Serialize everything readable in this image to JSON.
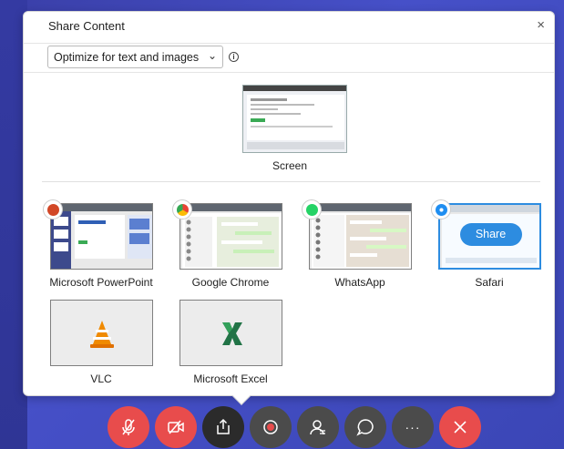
{
  "dialog": {
    "title": "Share Content",
    "close_glyph": "×",
    "optimize": {
      "selected": "Optimize for text and images",
      "chevron": "⌄",
      "info_glyph": "i"
    }
  },
  "screen": {
    "label": "Screen"
  },
  "apps": [
    {
      "label": "Microsoft PowerPoint",
      "icon": "powerpoint-icon",
      "color": "#d24726"
    },
    {
      "label": "Google Chrome",
      "icon": "chrome-icon",
      "color": "#4285f4"
    },
    {
      "label": "WhatsApp",
      "icon": "whatsapp-icon",
      "color": "#25d366"
    },
    {
      "label": "Safari",
      "icon": "safari-icon",
      "color": "#1f8ef1",
      "selected": true,
      "share_label": "Share"
    },
    {
      "label": "VLC",
      "icon": "vlc-icon",
      "color": "#f08a00"
    },
    {
      "label": "Microsoft Excel",
      "icon": "excel-icon",
      "color": "#217346"
    }
  ],
  "toolbar": {
    "buttons": [
      "mute-mic-icon",
      "stop-video-icon",
      "share-icon",
      "record-icon",
      "participants-icon",
      "chat-icon",
      "more-icon",
      "leave-icon"
    ],
    "more_glyph": "···"
  },
  "colors": {
    "accent": "#2d8ce0",
    "danger": "#e84c4c",
    "toolbar_dark": "#2b2b2b",
    "toolbar_grey": "#4b4b4b"
  }
}
